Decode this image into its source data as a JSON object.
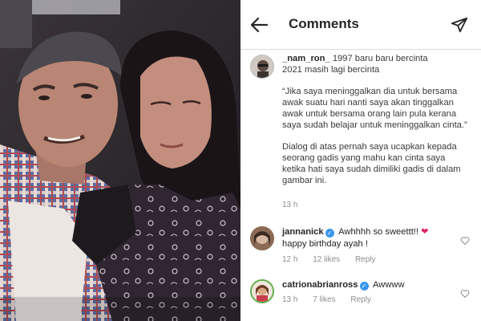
{
  "header": {
    "title": "Comments"
  },
  "post": {
    "username": "_nam_ron_",
    "caption_first": "1997 baru baru bercinta\n2021 masih lagi bercinta",
    "quote": "“Jika saya meninggalkan dia untuk bersama awak suatu hari nanti saya akan tinggalkan awak untuk bersama orang lain pula kerana saya sudah belajar untuk meninggalkan cinta.”",
    "dialog": "Dialog di atas pernah saya ucapkan kepada seorang gadis yang mahu kan cinta saya ketika hati saya sudah  dimiliki gadis di dalam gambar ini.",
    "time": "13 h"
  },
  "comments": [
    {
      "username": "jannanick",
      "verified": true,
      "text_line1": "Awhhhh so sweettt!!",
      "emoji": "❤",
      "text_line2": "happy birthday ayah !",
      "time": "12 h",
      "likes": "12 likes",
      "reply": "Reply"
    },
    {
      "username": "catrionabrianross",
      "verified": true,
      "text_line1": "Awwww",
      "time": "13 h",
      "likes": "7 likes",
      "reply": "Reply"
    }
  ],
  "colors": {
    "verified": "#3897f0",
    "muted": "#8e8e8e",
    "heart": "#e0245e"
  },
  "icons": {
    "back": "arrow-left-icon",
    "send": "paper-plane-icon",
    "like": "heart-outline-icon"
  }
}
